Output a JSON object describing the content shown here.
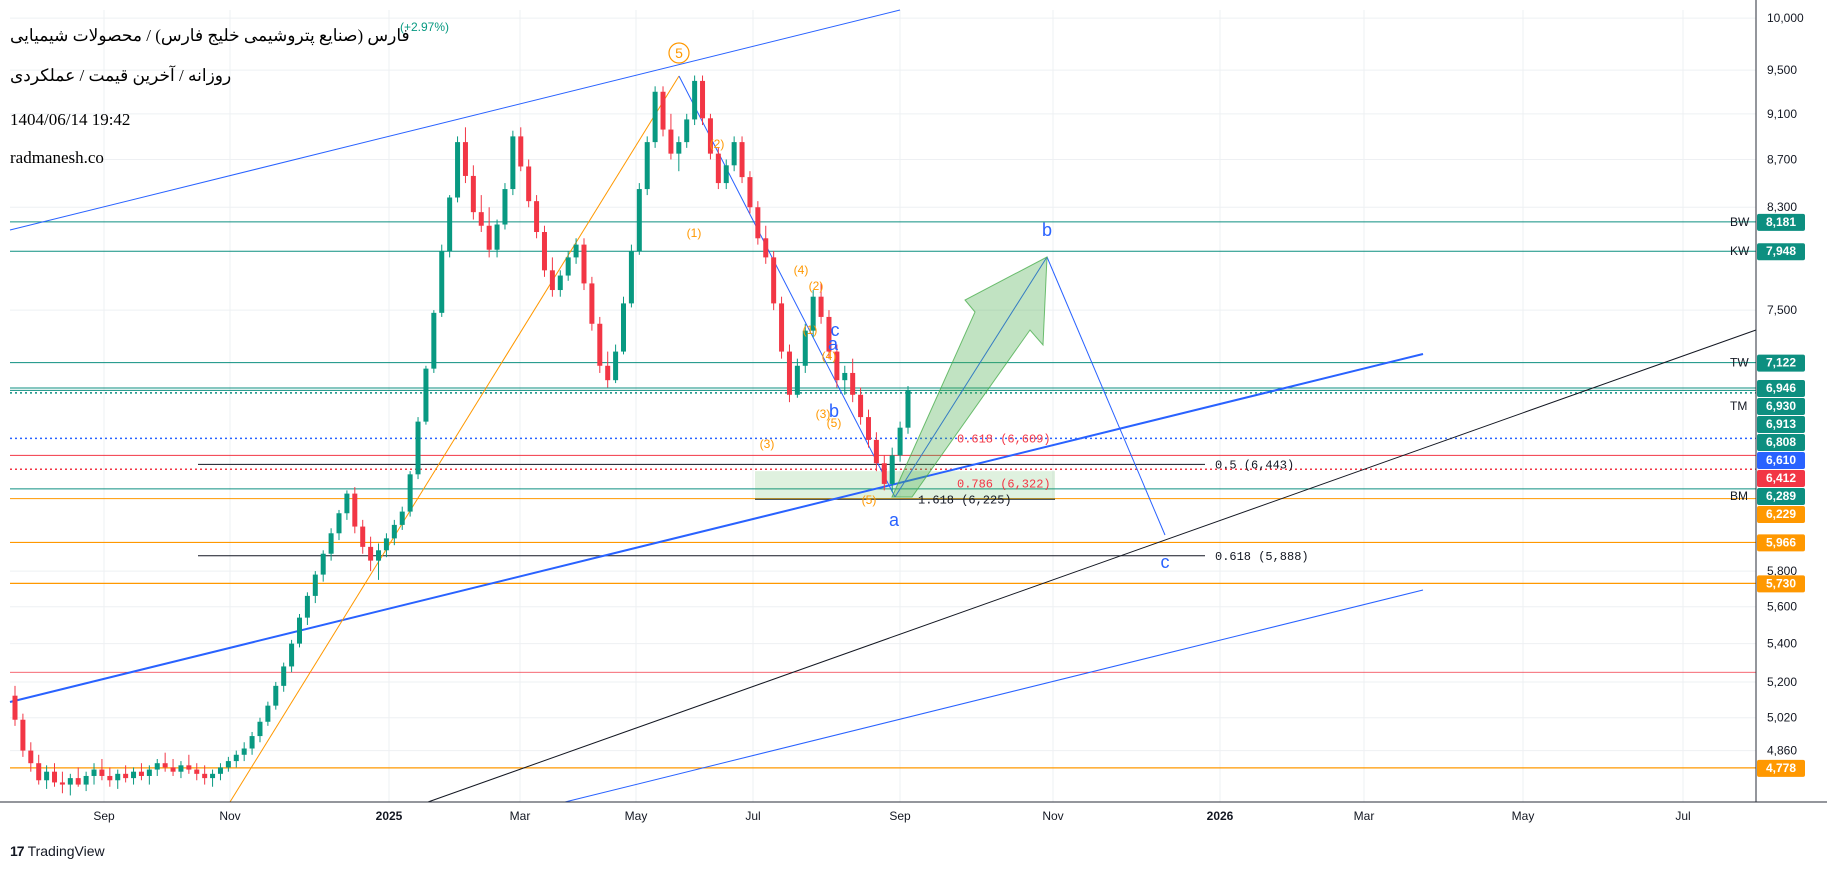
{
  "header": {
    "title": "فارس (صنایع پتروشیمی خلیج فارس) / محصولات شیمیایی",
    "subtitle": "روزانه / آخرین قیمت / عملکردی",
    "datetime": "1404/06/14 19:42",
    "site": "radmanesh.co",
    "change": "(+2.97%)"
  },
  "footer": {
    "brand": "TradingView"
  },
  "colors": {
    "bull": "#089981",
    "bear": "#f23645",
    "blue": "#2962ff",
    "orange": "#ff9800",
    "level_line": "#0d8f80",
    "grid": "#eef0f3",
    "axis_text": "#131722"
  },
  "chart_data": {
    "type": "candlestick",
    "title": "",
    "xlabel": "",
    "ylabel": "",
    "log_scale": true,
    "ylim": [
      4620,
      10080
    ],
    "x_ticks": [
      "Sep",
      "Nov",
      "2025",
      "Mar",
      "May",
      "Jul",
      "Sep",
      "Nov",
      "2026",
      "Mar",
      "May",
      "Jul"
    ],
    "y_ticks": [
      10000,
      9500,
      9100,
      8700,
      8300,
      7500,
      5800,
      5600,
      5400,
      5200,
      5020,
      4860
    ],
    "price_badges": [
      {
        "label": "BW",
        "value": "8,181",
        "kind": "green"
      },
      {
        "label": "KW",
        "value": "7,948",
        "kind": "green"
      },
      {
        "label": "TW",
        "value": "7,122",
        "kind": "green"
      },
      {
        "label": "",
        "value": "6,946",
        "kind": "green"
      },
      {
        "label": "TM",
        "value": "6,930",
        "kind": "green"
      },
      {
        "label": "",
        "value": "6,913",
        "kind": "green"
      },
      {
        "label": "",
        "value": "6,808",
        "kind": "green"
      },
      {
        "label": "",
        "value": "6,610",
        "kind": "blue"
      },
      {
        "label": "",
        "value": "6,412",
        "kind": "red"
      },
      {
        "label": "BM",
        "value": "6,289",
        "kind": "green"
      },
      {
        "label": "",
        "value": "6,229",
        "kind": "orange"
      },
      {
        "label": "",
        "value": "5,966",
        "kind": "orange"
      },
      {
        "label": "",
        "value": "5,730",
        "kind": "orange"
      },
      {
        "label": "",
        "value": "4,778",
        "kind": "orange"
      }
    ],
    "fib_labels": [
      {
        "text": "0.5 (6,443)",
        "color": "black"
      },
      {
        "text": "0.618 (6,609)",
        "color": "red"
      },
      {
        "text": "0.786 (6,322)",
        "color": "red"
      },
      {
        "text": "1.618 (6,225)",
        "color": "black"
      },
      {
        "text": "0.618 (5,888)",
        "color": "black"
      }
    ],
    "wave_labels": [
      {
        "text": "5",
        "color": "orange",
        "circled": true
      },
      {
        "text": "(1)",
        "color": "orange"
      },
      {
        "text": "(2)",
        "color": "orange"
      },
      {
        "text": "(3)",
        "color": "orange"
      },
      {
        "text": "(4)",
        "color": "orange"
      },
      {
        "text": "(2)",
        "color": "orange"
      },
      {
        "text": "(1)",
        "color": "orange"
      },
      {
        "text": "(4)",
        "color": "orange"
      },
      {
        "text": "(3)",
        "color": "orange"
      },
      {
        "text": "(5)",
        "color": "orange"
      },
      {
        "text": "(5)",
        "color": "orange"
      },
      {
        "text": "c",
        "color": "blue"
      },
      {
        "text": "a",
        "color": "blue"
      },
      {
        "text": "b",
        "color": "blue"
      },
      {
        "text": "a",
        "color": "blue"
      },
      {
        "text": "b",
        "color": "blue"
      },
      {
        "text": "c",
        "color": "blue"
      }
    ],
    "candles": [
      [
        5130,
        5180,
        4980,
        5010
      ],
      [
        5010,
        5040,
        4830,
        4860
      ],
      [
        4860,
        4900,
        4760,
        4800
      ],
      [
        4800,
        4840,
        4700,
        4720
      ],
      [
        4720,
        4790,
        4680,
        4760
      ],
      [
        4760,
        4800,
        4690,
        4710
      ],
      [
        4710,
        4760,
        4660,
        4700
      ],
      [
        4700,
        4750,
        4650,
        4730
      ],
      [
        4730,
        4780,
        4690,
        4700
      ],
      [
        4700,
        4760,
        4670,
        4740
      ],
      [
        4740,
        4800,
        4700,
        4770
      ],
      [
        4770,
        4820,
        4720,
        4740
      ],
      [
        4740,
        4780,
        4690,
        4720
      ],
      [
        4720,
        4770,
        4680,
        4750
      ],
      [
        4750,
        4790,
        4710,
        4730
      ],
      [
        4730,
        4780,
        4700,
        4760
      ],
      [
        4760,
        4800,
        4720,
        4740
      ],
      [
        4740,
        4790,
        4700,
        4770
      ],
      [
        4770,
        4820,
        4740,
        4800
      ],
      [
        4800,
        4850,
        4760,
        4780
      ],
      [
        4780,
        4820,
        4740,
        4760
      ],
      [
        4760,
        4810,
        4730,
        4790
      ],
      [
        4790,
        4840,
        4750,
        4770
      ],
      [
        4770,
        4800,
        4720,
        4750
      ],
      [
        4750,
        4790,
        4700,
        4730
      ],
      [
        4730,
        4770,
        4690,
        4750
      ],
      [
        4750,
        4800,
        4720,
        4780
      ],
      [
        4780,
        4830,
        4760,
        4810
      ],
      [
        4810,
        4860,
        4780,
        4840
      ],
      [
        4840,
        4900,
        4810,
        4870
      ],
      [
        4870,
        4950,
        4840,
        4930
      ],
      [
        4930,
        5020,
        4900,
        5000
      ],
      [
        5000,
        5100,
        4980,
        5080
      ],
      [
        5080,
        5200,
        5060,
        5180
      ],
      [
        5180,
        5300,
        5150,
        5280
      ],
      [
        5280,
        5420,
        5250,
        5400
      ],
      [
        5400,
        5560,
        5380,
        5540
      ],
      [
        5540,
        5680,
        5500,
        5660
      ],
      [
        5660,
        5800,
        5620,
        5780
      ],
      [
        5780,
        5920,
        5740,
        5900
      ],
      [
        5900,
        6050,
        5860,
        6020
      ],
      [
        6020,
        6160,
        5980,
        6140
      ],
      [
        6140,
        6280,
        6100,
        6260
      ],
      [
        6260,
        6300,
        6020,
        6060
      ],
      [
        6060,
        6100,
        5900,
        5940
      ],
      [
        5940,
        6000,
        5800,
        5860
      ],
      [
        5860,
        5960,
        5750,
        5920
      ],
      [
        5920,
        6020,
        5880,
        5990
      ],
      [
        5990,
        6100,
        5950,
        6070
      ],
      [
        6070,
        6180,
        6040,
        6150
      ],
      [
        6150,
        6400,
        6120,
        6380
      ],
      [
        6380,
        6750,
        6350,
        6720
      ],
      [
        6720,
        7100,
        6700,
        7080
      ],
      [
        7080,
        7500,
        7050,
        7480
      ],
      [
        7480,
        8000,
        7450,
        7950
      ],
      [
        7950,
        8400,
        7900,
        8380
      ],
      [
        8380,
        8900,
        8340,
        8850
      ],
      [
        8850,
        8980,
        8500,
        8560
      ],
      [
        8560,
        8650,
        8200,
        8260
      ],
      [
        8260,
        8400,
        8100,
        8150
      ],
      [
        8150,
        8300,
        7900,
        7960
      ],
      [
        7960,
        8200,
        7900,
        8160
      ],
      [
        8160,
        8500,
        8120,
        8450
      ],
      [
        8450,
        8950,
        8400,
        8900
      ],
      [
        8900,
        8980,
        8600,
        8640
      ],
      [
        8640,
        8700,
        8300,
        8350
      ],
      [
        8350,
        8400,
        8050,
        8100
      ],
      [
        8100,
        8150,
        7750,
        7800
      ],
      [
        7800,
        7900,
        7600,
        7650
      ],
      [
        7650,
        7800,
        7600,
        7760
      ],
      [
        7760,
        7950,
        7720,
        7900
      ],
      [
        7900,
        8050,
        7850,
        8000
      ],
      [
        8000,
        8050,
        7650,
        7700
      ],
      [
        7700,
        7750,
        7350,
        7400
      ],
      [
        7400,
        7450,
        7050,
        7100
      ],
      [
        7100,
        7200,
        6950,
        7000
      ],
      [
        7000,
        7250,
        6980,
        7200
      ],
      [
        7200,
        7600,
        7180,
        7550
      ],
      [
        7550,
        8000,
        7520,
        7950
      ],
      [
        7950,
        8500,
        7920,
        8450
      ],
      [
        8450,
        8900,
        8400,
        8850
      ],
      [
        8850,
        9350,
        8800,
        9300
      ],
      [
        9300,
        9350,
        8900,
        8960
      ],
      [
        8960,
        9100,
        8700,
        8750
      ],
      [
        8750,
        8900,
        8600,
        8850
      ],
      [
        8850,
        9100,
        8800,
        9050
      ],
      [
        9050,
        9450,
        9000,
        9400
      ],
      [
        9400,
        9450,
        9000,
        9060
      ],
      [
        9060,
        9100,
        8700,
        8750
      ],
      [
        8750,
        8800,
        8450,
        8500
      ],
      [
        8500,
        8700,
        8450,
        8650
      ],
      [
        8650,
        8900,
        8600,
        8850
      ],
      [
        8850,
        8900,
        8500,
        8550
      ],
      [
        8550,
        8600,
        8250,
        8300
      ],
      [
        8300,
        8350,
        8000,
        8050
      ],
      [
        8050,
        8150,
        7850,
        7900
      ],
      [
        7900,
        7950,
        7500,
        7550
      ],
      [
        7550,
        7600,
        7150,
        7200
      ],
      [
        7200,
        7250,
        6850,
        6900
      ],
      [
        6900,
        7150,
        6880,
        7100
      ],
      [
        7100,
        7400,
        7050,
        7350
      ],
      [
        7350,
        7650,
        7300,
        7600
      ],
      [
        7600,
        7700,
        7400,
        7450
      ],
      [
        7450,
        7500,
        7150,
        7200
      ],
      [
        7200,
        7250,
        6950,
        7000
      ],
      [
        7000,
        7100,
        6900,
        7050
      ],
      [
        7050,
        7150,
        6850,
        6900
      ],
      [
        6900,
        6950,
        6700,
        6750
      ],
      [
        6750,
        6800,
        6550,
        6600
      ],
      [
        6600,
        6650,
        6400,
        6450
      ],
      [
        6450,
        6500,
        6280,
        6320
      ],
      [
        6320,
        6550,
        6270,
        6500
      ],
      [
        6500,
        6720,
        6460,
        6680
      ],
      [
        6680,
        6960,
        6640,
        6930
      ]
    ]
  }
}
